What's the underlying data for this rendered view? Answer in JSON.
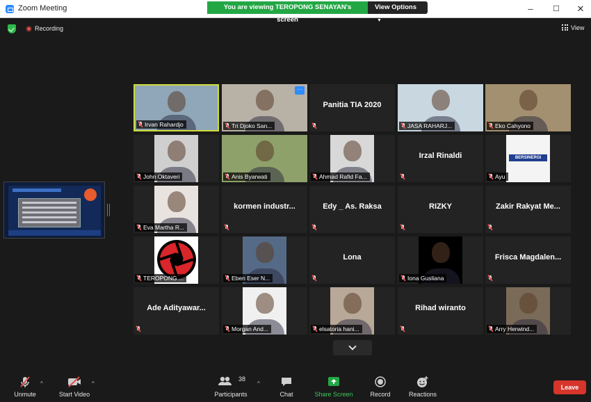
{
  "window": {
    "title": "Zoom Meeting",
    "minimize": "–",
    "maximize": "☐",
    "close": "✕"
  },
  "banner": {
    "message": "You are viewing TEROPONG SENAYAN's screen",
    "options_label": "View Options"
  },
  "status": {
    "recording_label": "Recording",
    "view_label": "View"
  },
  "tiles": [
    {
      "name": "Irvan Rahardjo",
      "video": true,
      "active": true,
      "bg": "#8fa7b8"
    },
    {
      "name": "Tri Djoko San...",
      "video": true,
      "bg": "#b8b1a6",
      "more": "···"
    },
    {
      "name": "Panitia TIA 2020",
      "video": false,
      "title": "Panitia TIA 2020"
    },
    {
      "name": "JASA RAHARJ...",
      "video": true,
      "bg": "#c9d7e0"
    },
    {
      "name": "Eko Cahyono",
      "video": true,
      "bg": "#a39070"
    },
    {
      "name": "John Oktaveri",
      "video": true,
      "bg": "#cfcfcf",
      "narrow": true
    },
    {
      "name": "Anis Byarwati",
      "video": true,
      "bg": "#8fa16a"
    },
    {
      "name": "Ahmad Rafid Fa...",
      "video": true,
      "bg": "#d8d8d8",
      "narrow": true
    },
    {
      "name": "Irzal Rinaldi",
      "video": false,
      "title": "Irzal Rinaldi"
    },
    {
      "name": "Ayu",
      "video": true,
      "bg": "#f4f4f4",
      "narrow": true,
      "poster": "BERSINERGI"
    },
    {
      "name": "Eva Martha R...",
      "video": true,
      "bg": "#e9e3e0",
      "narrow": true
    },
    {
      "name": "kormen industr...",
      "video": false,
      "title": "kormen  industr..."
    },
    {
      "name": "Edy _ As. Raksa",
      "video": false,
      "title": "Edy _ As. Raksa"
    },
    {
      "name": "RIZKY",
      "video": false,
      "title": "RIZKY"
    },
    {
      "name": "Zakir Rakyat Me...",
      "video": false,
      "title": "Zakir  Rakyat  Me..."
    },
    {
      "name": "TEROPONG ...",
      "video": true,
      "bg": "#ffffff",
      "narrow": true,
      "logo": true
    },
    {
      "name": "Eben Eser N...",
      "video": true,
      "bg": "#556a86",
      "narrow": true
    },
    {
      "name": "Lona",
      "video": false,
      "title": "Lona"
    },
    {
      "name": "Iona Gusliana",
      "video": true,
      "bg": "#000000",
      "narrow": true
    },
    {
      "name": "Frisca Magdalen...",
      "video": false,
      "title": "Frisca  Magdalen..."
    },
    {
      "name": "Ade Adityawar...",
      "video": false,
      "title": "Ade  Adityawar..."
    },
    {
      "name": "Morgan And...",
      "video": true,
      "bg": "#f0f0f0",
      "narrow": true
    },
    {
      "name": "elsatoria hani...",
      "video": true,
      "bg": "#b8a898",
      "narrow": true
    },
    {
      "name": "Rihad wiranto",
      "video": false,
      "title": "Rihad wiranto"
    },
    {
      "name": "Arry Herwind...",
      "video": true,
      "bg": "#7a6a58",
      "narrow": true
    }
  ],
  "toolbar": {
    "unmute": "Unmute",
    "start_video": "Start Video",
    "participants": "Participants",
    "participants_count": "38",
    "chat": "Chat",
    "share_screen": "Share Screen",
    "record": "Record",
    "reactions": "Reactions",
    "leave": "Leave"
  },
  "colors": {
    "share_green": "#23a745",
    "leave_red": "#d7352b",
    "active_border": "#cddc39",
    "accent_blue": "#2d8cff"
  }
}
